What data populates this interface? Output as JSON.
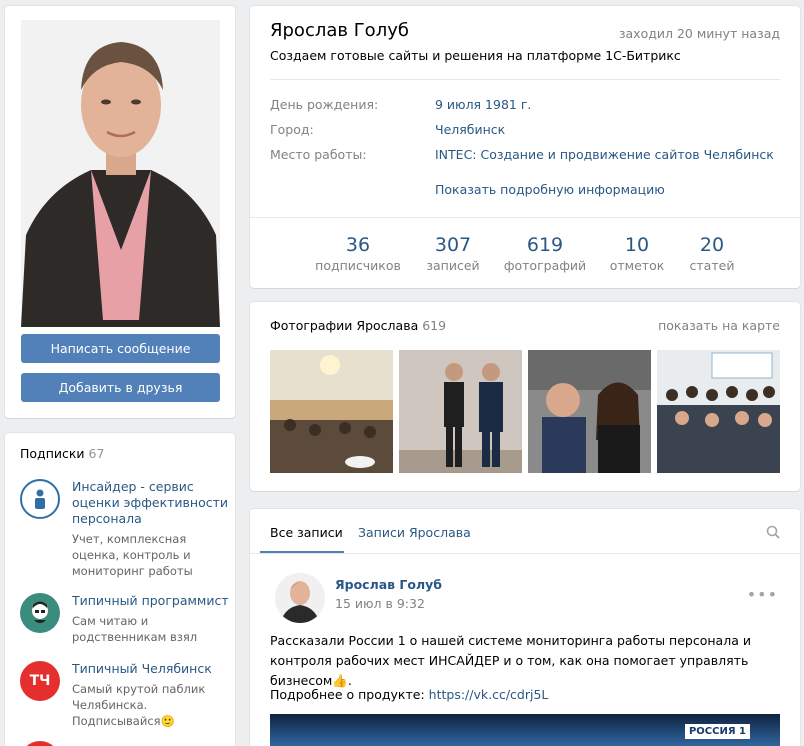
{
  "profile": {
    "name": "Ярослав Голуб",
    "last_seen": "заходил 20 минут назад",
    "status": "Создаем готовые сайты и решения на платформе 1С-Битрикс",
    "info": [
      {
        "label": "День рождения:",
        "value": "9 июля 1981 г."
      },
      {
        "label": "Город:",
        "value": "Челябинск"
      },
      {
        "label": "Место работы:",
        "value": "INTEC: Создание и продвижение сайтов Челябинск"
      }
    ],
    "more_info_link": "Показать подробную информацию",
    "counters": [
      {
        "value": "36",
        "label": "подписчиков"
      },
      {
        "value": "307",
        "label": "записей"
      },
      {
        "value": "619",
        "label": "фотографий"
      },
      {
        "value": "10",
        "label": "отметок"
      },
      {
        "value": "20",
        "label": "статей"
      }
    ]
  },
  "actions": {
    "message_button": "Написать сообщение",
    "add_friend_button": "Добавить в друзья"
  },
  "subscriptions": {
    "title": "Подписки",
    "count": "67",
    "items": [
      {
        "name": "Инсайдер - сервис оценки эффективности персонала",
        "desc": "Учет, комплексная оценка, контроль и мониторинг работы",
        "icon": "insider-logo-icon"
      },
      {
        "name": "Типичный программист",
        "desc": "Сам читаю и родственникам взял",
        "icon": "programmer-logo-icon"
      },
      {
        "name": "Типичный Челябинск",
        "desc": "Самый крутой паблик Челябинска. Подписывайся🙂",
        "icon": "tch-logo-icon",
        "icon_text": "ТЧ"
      }
    ]
  },
  "photos": {
    "title": "Фотографии Ярослава",
    "count": "619",
    "map_link": "показать на карте"
  },
  "wall": {
    "tabs": [
      "Все записи",
      "Записи Ярослава"
    ],
    "post": {
      "author": "Ярослав Голуб",
      "date": "15 июл в 9:32",
      "text": "Рассказали России 1 о нашей системе мониторинга работы персонала и контроля рабочих мест ИНСАЙДЕР и о том, как она помогает управлять бизнесом👍.",
      "link_prefix": "Подробнее о продукте:",
      "link": "https://vk.cc/cdrj5L",
      "image_badge": "РОССИЯ 1"
    }
  },
  "colors": {
    "accent": "#5181b8",
    "link": "#2a5885",
    "background": "#edeef0"
  }
}
